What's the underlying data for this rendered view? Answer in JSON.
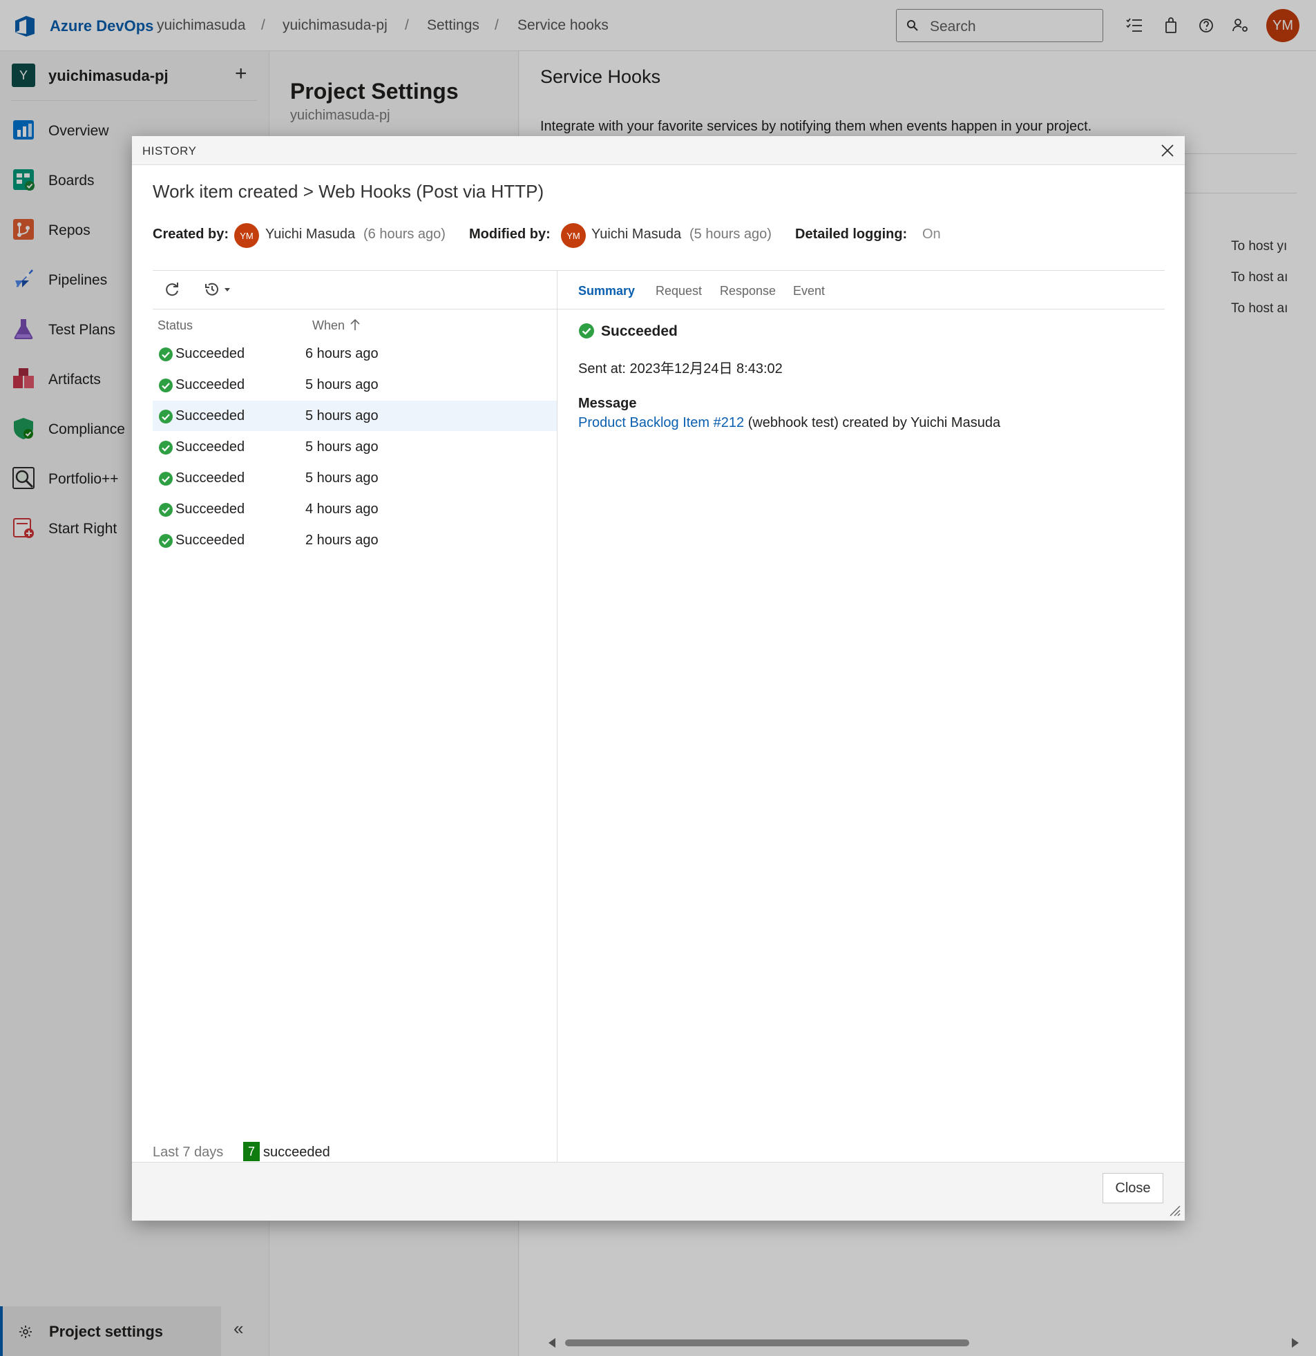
{
  "topbar": {
    "brand": "Azure DevOps",
    "breadcrumbs": [
      "yuichimasuda",
      "yuichimasuda-pj",
      "Settings",
      "Service hooks"
    ],
    "separator": "/",
    "search_placeholder": "Search",
    "avatar_initials": "YM"
  },
  "sidebar": {
    "project_initial": "Y",
    "project_name": "yuichimasuda-pj",
    "add_label": "+",
    "items": [
      {
        "label": "Overview",
        "color": "#0078d4"
      },
      {
        "label": "Boards",
        "color": "#009c7c"
      },
      {
        "label": "Repos",
        "color": "#e05d30"
      },
      {
        "label": "Pipelines",
        "color": "#2f6cdc"
      },
      {
        "label": "Test Plans",
        "color": "#7b4fb8"
      },
      {
        "label": "Artifacts",
        "color": "#c7354b"
      },
      {
        "label": "Compliance",
        "color": "#1e9d5a"
      },
      {
        "label": "Portfolio++",
        "color": "#2b2b2b"
      },
      {
        "label": "Start Right",
        "color": "#d13438"
      }
    ],
    "project_settings_label": "Project settings",
    "collapse_label": "«"
  },
  "settings_column": {
    "title": "Project Settings",
    "subtitle": "yuichimasuda-pj"
  },
  "main": {
    "title": "Service Hooks",
    "description": "Integrate with your favorite services by notifying them when events happen in your project.",
    "row_texts": [
      "To host yı",
      "To host aı",
      "To host aı"
    ]
  },
  "dialog": {
    "header": "HISTORY",
    "title": "Work item created > Web Hooks (Post via HTTP)",
    "created_by_label": "Created by:",
    "created_by_initials": "YM",
    "created_by_name": "Yuichi Masuda",
    "created_time": "(6 hours ago)",
    "modified_by_label": "Modified by:",
    "modified_by_initials": "YM",
    "modified_by_name": "Yuichi Masuda",
    "modified_time": "(5 hours ago)",
    "logging_label": "Detailed logging:",
    "logging_value": "On",
    "columns": {
      "status": "Status",
      "when": "When"
    },
    "history": [
      {
        "status": "Succeeded",
        "when": "6 hours ago"
      },
      {
        "status": "Succeeded",
        "when": "5 hours ago"
      },
      {
        "status": "Succeeded",
        "when": "5 hours ago"
      },
      {
        "status": "Succeeded",
        "when": "5 hours ago"
      },
      {
        "status": "Succeeded",
        "when": "5 hours ago"
      },
      {
        "status": "Succeeded",
        "when": "4 hours ago"
      },
      {
        "status": "Succeeded",
        "when": "2 hours ago"
      }
    ],
    "footer_range": "Last 7 days",
    "footer_count": "7",
    "footer_result": "succeeded",
    "tabs": [
      "Summary",
      "Request",
      "Response",
      "Event"
    ],
    "detail": {
      "status": "Succeeded",
      "sent_at": "Sent at: 2023年12月24日 8:43:02",
      "message_label": "Message",
      "message_link": "Product Backlog Item #212",
      "message_rest": " (webhook test) created by Yuichi Masuda"
    },
    "close_label": "Close"
  },
  "colors": {
    "accent": "#0a5fb0",
    "success": "#2ea043",
    "avatar": "#c43d0c",
    "badge": "#107c10"
  }
}
